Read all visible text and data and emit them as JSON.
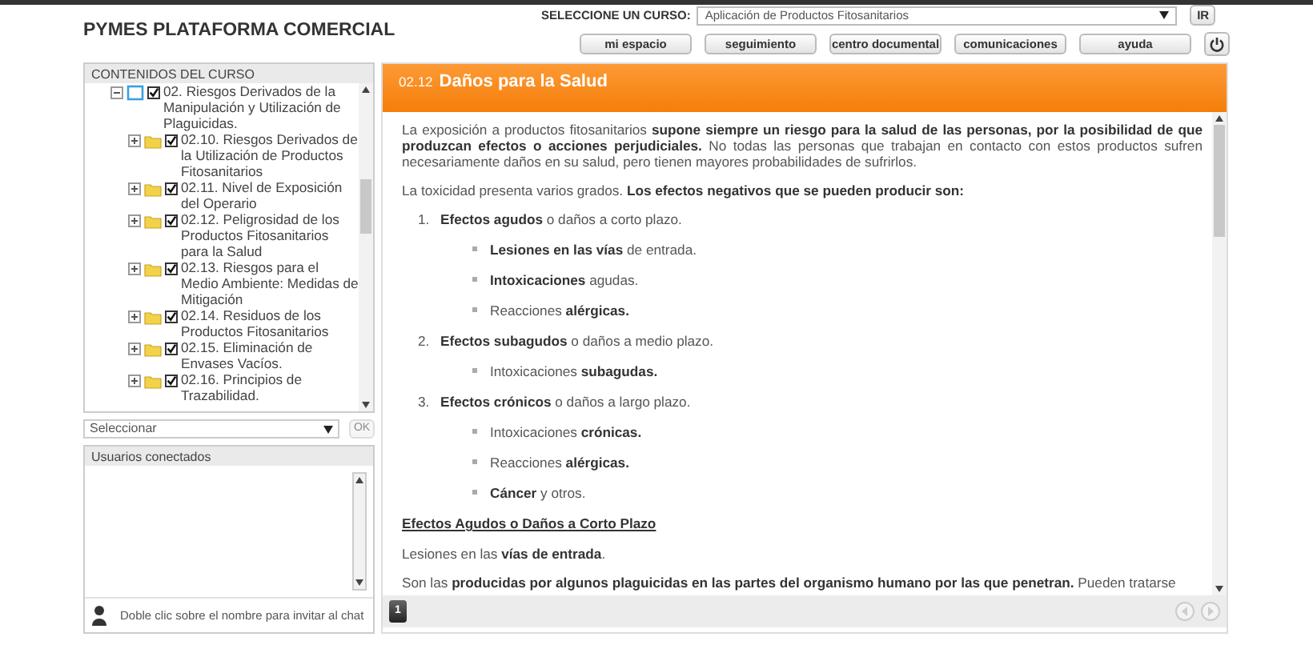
{
  "header": {
    "title": "PYMES PLATAFORMA COMERCIAL",
    "course_label": "SELECCIONE UN CURSO:",
    "course_value": "Aplicación de Productos Fitosanitarios",
    "go_button": "IR",
    "nav_buttons": [
      "mi espacio",
      "seguimiento",
      "centro documental",
      "comunicaciones",
      "ayuda"
    ]
  },
  "sidebar": {
    "title": "CONTENIDOS DEL CURSO",
    "tree": [
      {
        "label": "02. Riesgos Derivados de la Manipulación y Utilización de Plaguicidas.",
        "checked": true,
        "expanded": true,
        "children": [
          {
            "label": "02.10. Riesgos Derivados de la Utilización de Productos Fitosanitarios",
            "checked": true,
            "expanded": false
          },
          {
            "label": "02.11. Nivel de Exposición del Operario",
            "checked": true,
            "expanded": false
          },
          {
            "label": "02.12. Peligrosidad de los Productos Fitosanitarios para la Salud",
            "checked": true,
            "expanded": false
          },
          {
            "label": "02.13. Riesgos para el Medio Ambiente: Medidas de Mitigación",
            "checked": true,
            "expanded": false
          },
          {
            "label": "02.14. Residuos de los Productos Fitosanitarios",
            "checked": true,
            "expanded": false
          },
          {
            "label": "02.15. Eliminación de Envases Vacíos.",
            "checked": true,
            "expanded": false
          },
          {
            "label": "02.16. Principios de Trazabilidad.",
            "checked": true,
            "expanded": false
          }
        ]
      }
    ],
    "select_value": "Seleccionar",
    "ok_button": "OK",
    "users_title": "Usuarios conectados",
    "users_hint": "Doble clic sobre el nombre para invitar al chat"
  },
  "content": {
    "number": "02.12",
    "title": "Daños para la Salud",
    "blocks": [
      {
        "kind": "paragraph",
        "text": "La exposición a productos fitosanitarios **supone siempre un riesgo para la salud de las personas, por la posibilidad de que produzcan efectos o acciones perjudiciales.** No todas las personas que trabajan en contacto con estos productos sufren necesariamente daños en su salud, pero tienen mayores probabilidades de sufrirlos."
      },
      {
        "kind": "paragraph",
        "text": "La toxicidad presenta varios grados. **Los efectos negativos que se pueden producir son:**"
      },
      {
        "kind": "list",
        "items": [
          {
            "number": "1.",
            "text": "**Efectos agudos** o daños a corto plazo.",
            "children": [
              "**Lesiones en las vías** de entrada.",
              "**Intoxicaciones** agudas.",
              "Reacciones **alérgicas.**"
            ]
          },
          {
            "number": "2.",
            "text": "**Efectos subagudos** o daños a medio plazo.",
            "children": [
              "Intoxicaciones **subagudas.**"
            ]
          },
          {
            "number": "3.",
            "text": "**Efectos crónicos** o daños a largo plazo.",
            "children": [
              "Intoxicaciones **crónicas.**",
              "Reacciones **alérgicas.**",
              "**Cáncer** y otros."
            ]
          }
        ]
      },
      {
        "kind": "heading",
        "text": "Efectos Agudos o Daños a Corto Plazo"
      },
      {
        "kind": "paragraph",
        "text": "Lesiones en las **vías de entrada**."
      },
      {
        "kind": "paragraph",
        "text": "Son las **producidas por algunos plaguicidas en las partes del organismo humano por las que penetran.** Pueden tratarse"
      }
    ],
    "page_button": "1"
  }
}
